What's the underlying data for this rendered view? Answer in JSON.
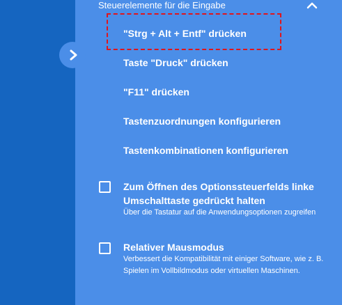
{
  "section": {
    "header": "Steuerelemente für die Eingabe"
  },
  "menu": {
    "items": [
      {
        "label": "\"Strg + Alt + Entf\" drücken"
      },
      {
        "label": "Taste \"Druck\" drücken"
      },
      {
        "label": "\"F11\" drücken"
      },
      {
        "label": "Tastenzuordnungen konfigurieren"
      },
      {
        "label": "Tastenkombinationen konfigurieren"
      }
    ]
  },
  "options": [
    {
      "title": "Zum Öffnen des Optionssteuerfelds linke Umschalttaste gedrückt halten",
      "description": "Über die Tastatur auf die Anwendungsoptionen zugreifen",
      "checked": false
    },
    {
      "title": "Relativer Mausmodus",
      "description": "Verbessert die Kompatibilität mit einiger Software, wie z. B. Spielen im Vollbildmodus oder virtuellen Maschinen.",
      "checked": false
    }
  ],
  "icons": {
    "toggle": "chevron-right-icon",
    "collapse": "chevron-up-icon"
  },
  "colors": {
    "background_dark": "#1565c0",
    "panel": "#4b8ee8",
    "text": "#ffffff",
    "highlight": "#e0151b"
  }
}
